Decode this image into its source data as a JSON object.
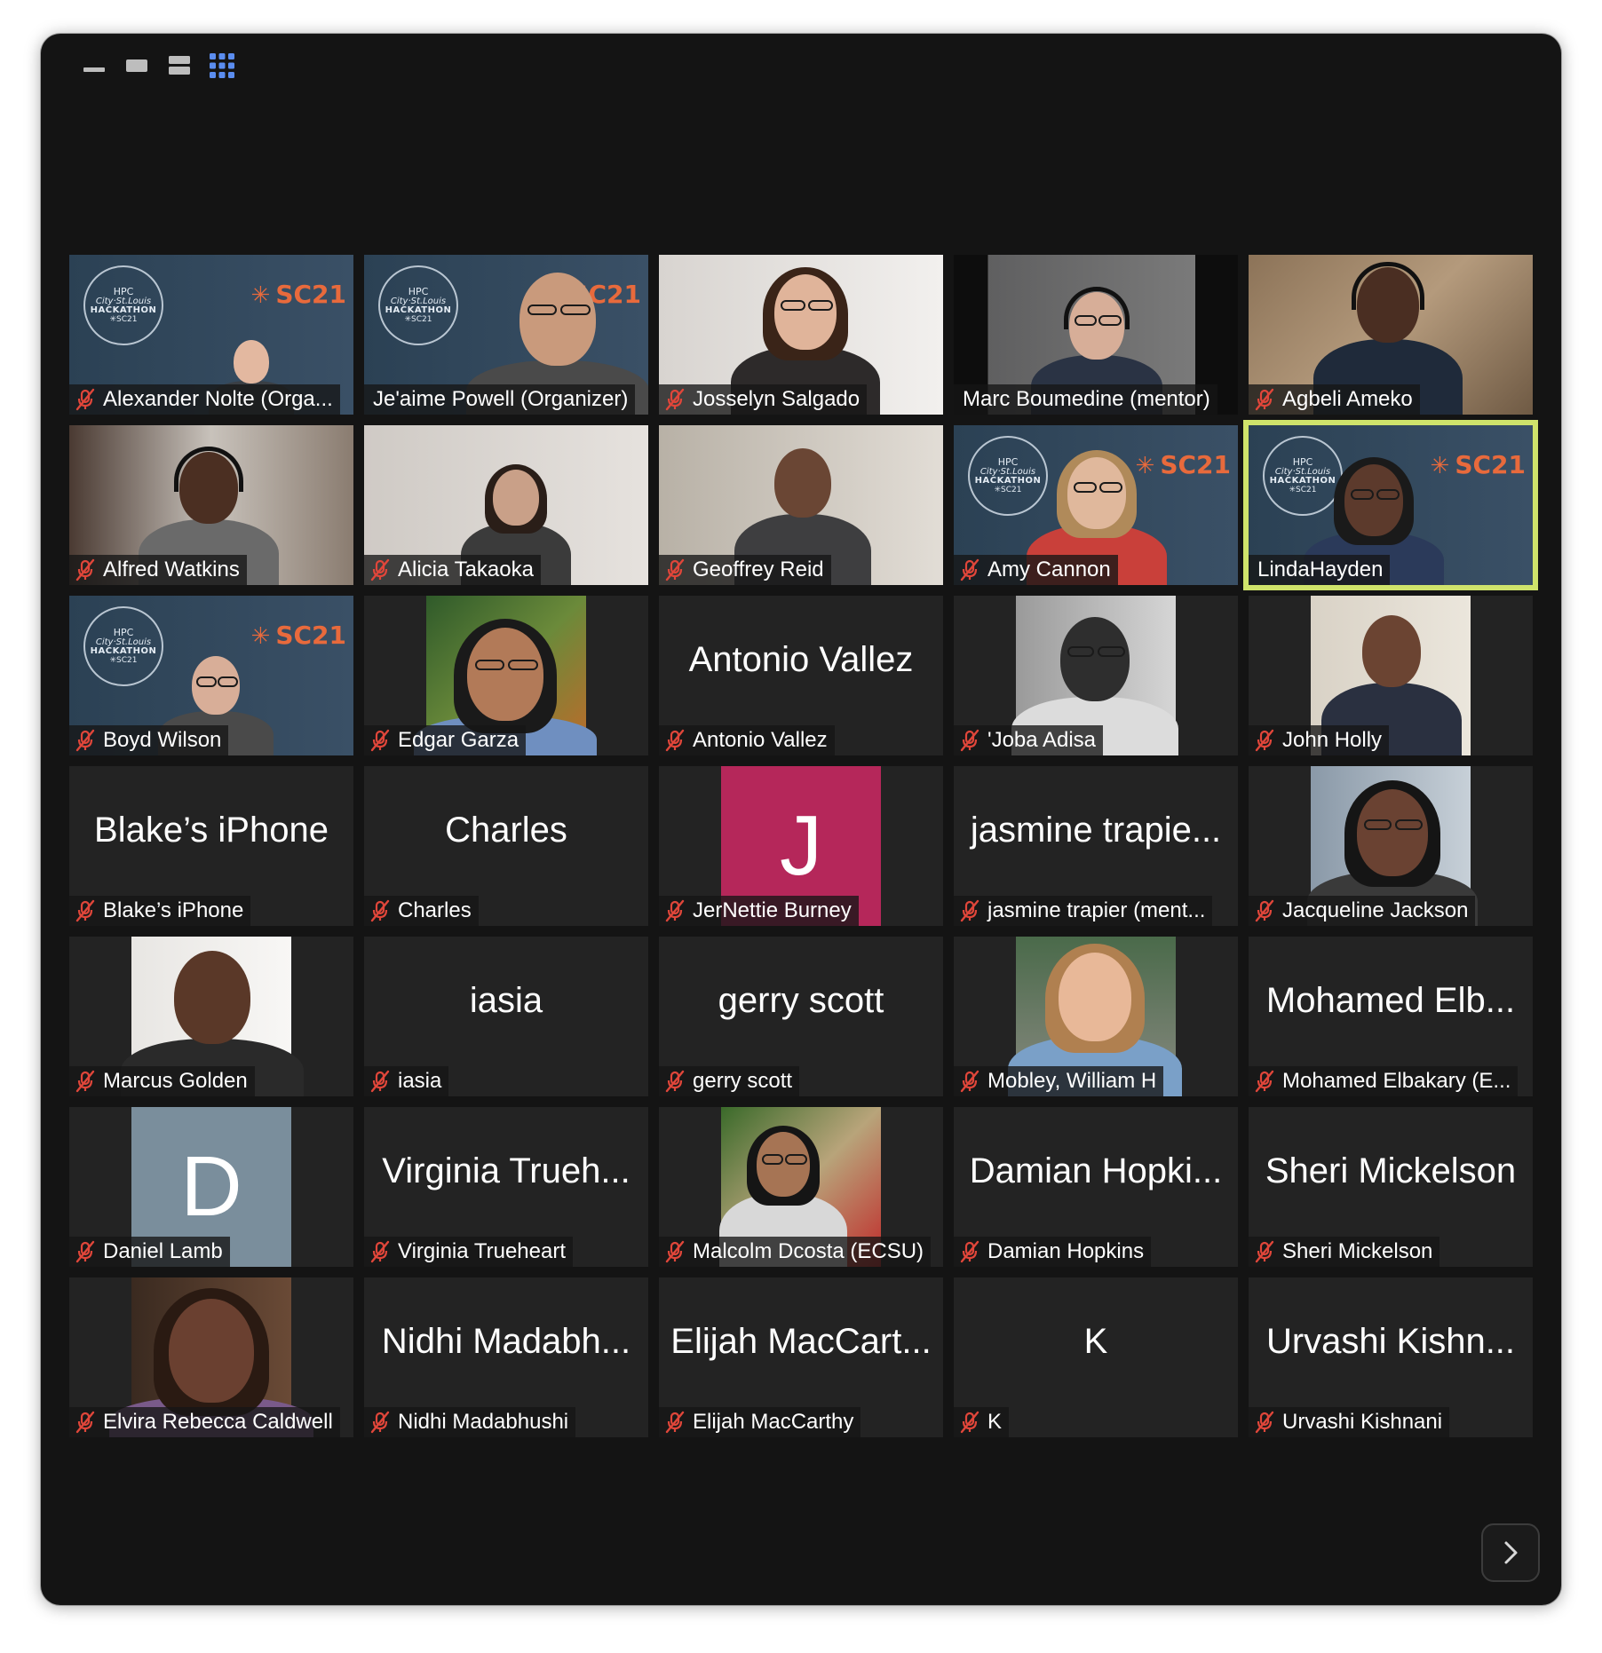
{
  "window": {
    "background_color": "#141414",
    "speaker_highlight_color": "#cfe36b"
  },
  "toolbar": {
    "buttons": [
      {
        "name": "minimize-view",
        "icon": "minus-icon"
      },
      {
        "name": "speaker-view",
        "icon": "single-rect-icon"
      },
      {
        "name": "stacked-view",
        "icon": "two-rect-icon"
      },
      {
        "name": "gallery-view",
        "icon": "grid-icon",
        "active": true,
        "active_color": "#5b8def"
      }
    ]
  },
  "banner": {
    "logo_line1": "HPC",
    "logo_line2": "City·St.Louis",
    "logo_line3": "HACKATHON",
    "logo_line4": "✳SC21",
    "event": "SC21"
  },
  "participants": [
    {
      "name": "Alexander Nolte (Orga...",
      "muted": true,
      "video": "banner"
    },
    {
      "name": "Je'aime Powell (Organizer)",
      "muted": false,
      "video": "banner"
    },
    {
      "name": "Josselyn Salgado",
      "muted": true,
      "video": "camera"
    },
    {
      "name": "Marc Boumedine (mentor)",
      "muted": false,
      "video": "camera"
    },
    {
      "name": "Agbeli Ameko",
      "muted": true,
      "video": "camera"
    },
    {
      "name": "Alfred Watkins",
      "muted": true,
      "video": "camera"
    },
    {
      "name": "Alicia Takaoka",
      "muted": true,
      "video": "camera"
    },
    {
      "name": "Geoffrey Reid",
      "muted": true,
      "video": "camera"
    },
    {
      "name": "Amy Cannon",
      "muted": true,
      "video": "banner"
    },
    {
      "name": "LindaHayden",
      "muted": false,
      "video": "banner",
      "active_speaker": true
    },
    {
      "name": "Boyd Wilson",
      "muted": true,
      "video": "banner"
    },
    {
      "name": "Edgar Garza",
      "muted": true,
      "video": "photo"
    },
    {
      "name": "Antonio Vallez",
      "muted": true,
      "video": "none",
      "display_name": "Antonio Vallez"
    },
    {
      "name": "'Joba Adisa",
      "muted": true,
      "video": "photo"
    },
    {
      "name": "John Holly",
      "muted": true,
      "video": "photo"
    },
    {
      "name": "Blake’s iPhone",
      "muted": true,
      "video": "none",
      "display_name": "Blake’s iPhone"
    },
    {
      "name": "Charles",
      "muted": true,
      "video": "none",
      "display_name": "Charles"
    },
    {
      "name": "JerNettie Burney",
      "muted": true,
      "video": "avatar",
      "avatar_letter": "J",
      "avatar_color": "#b5275a"
    },
    {
      "name": "jasmine trapier (ment...",
      "muted": true,
      "video": "none",
      "display_name": "jasmine trapie..."
    },
    {
      "name": "Jacqueline Jackson",
      "muted": true,
      "video": "photo"
    },
    {
      "name": "Marcus Golden",
      "muted": true,
      "video": "photo"
    },
    {
      "name": "iasia",
      "muted": true,
      "video": "none",
      "display_name": "iasia"
    },
    {
      "name": "gerry scott",
      "muted": true,
      "video": "none",
      "display_name": "gerry scott"
    },
    {
      "name": "Mobley, William H",
      "muted": true,
      "video": "photo"
    },
    {
      "name": "Mohamed Elbakary (E...",
      "muted": true,
      "video": "none",
      "display_name": "Mohamed Elb..."
    },
    {
      "name": "Daniel Lamb",
      "muted": true,
      "video": "avatar",
      "avatar_letter": "D",
      "avatar_color": "#7a8e9c"
    },
    {
      "name": "Virginia Trueheart",
      "muted": true,
      "video": "none",
      "display_name": "Virginia Trueh..."
    },
    {
      "name": "Malcolm Dcosta (ECSU)",
      "muted": true,
      "video": "photo"
    },
    {
      "name": "Damian Hopkins",
      "muted": true,
      "video": "none",
      "display_name": "Damian Hopki..."
    },
    {
      "name": "Sheri Mickelson",
      "muted": true,
      "video": "none",
      "display_name": "Sheri Mickelson"
    },
    {
      "name": "Elvira Rebecca Caldwell",
      "muted": true,
      "video": "photo"
    },
    {
      "name": "Nidhi Madabhushi",
      "muted": true,
      "video": "none",
      "display_name": "Nidhi Madabh..."
    },
    {
      "name": "Elijah MacCarthy",
      "muted": true,
      "video": "none",
      "display_name": "Elijah MacCart..."
    },
    {
      "name": "K",
      "muted": true,
      "video": "none",
      "display_name": "K"
    },
    {
      "name": "Urvashi Kishnani",
      "muted": true,
      "video": "none",
      "display_name": "Urvashi Kishn..."
    }
  ],
  "pagination": {
    "next_icon": "chevron-right-icon"
  }
}
